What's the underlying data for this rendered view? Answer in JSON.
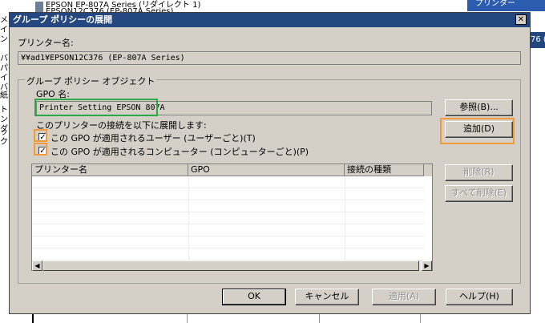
{
  "background": {
    "printer_rows": [
      "EPSON EP-807A Series (リダイレクト 1)",
      "EPSON12C376 (EP-807A Series)"
    ],
    "left_chars": [
      "メイン",
      "バ",
      "パ",
      "イバ",
      "紙",
      "ト",
      "ンダ",
      "ック"
    ],
    "right_panel_label": "プリンター",
    "right_strip_label": "76 ("
  },
  "dialog": {
    "title": "グループ ポリシーの展開",
    "close_label": "✕",
    "printer_name_label": "プリンター名:",
    "printer_name_value": "¥¥ad1¥EPSON12C376 (EP-807A Series)",
    "group_caption": "グループ ポリシー オブジェクト",
    "gpo_name_label": "GPO 名:",
    "gpo_name_value": "Printer Setting EPSON 807A",
    "browse_button": "参照(B)...",
    "deploy_label": "このプリンターの接続を以下に展開します:",
    "add_button": "追加(D)",
    "checkbox_users": {
      "label": "この GPO が適用されるユーザー (ユーザーごと)(T)",
      "checked": true
    },
    "checkbox_computers": {
      "label": "この GPO が適用されるコンピューター (コンピューターごと)(P)",
      "checked": true
    },
    "list_columns": [
      "プリンター名",
      "GPO",
      "接続の種類"
    ],
    "remove_button": "削除(R)",
    "remove_all_button": "すべて削除(E)",
    "ok_button": "OK",
    "cancel_button": "キャンセル",
    "apply_button": "適用(A)",
    "help_button": "ヘルプ(H)"
  },
  "colors": {
    "title_bar": "#24477f",
    "highlight_green": "#2aa84a",
    "highlight_orange": "#f39a3c"
  },
  "icons": {
    "close": "close-icon",
    "scroll_left": "arrow-left-icon",
    "scroll_right": "arrow-right-icon"
  }
}
